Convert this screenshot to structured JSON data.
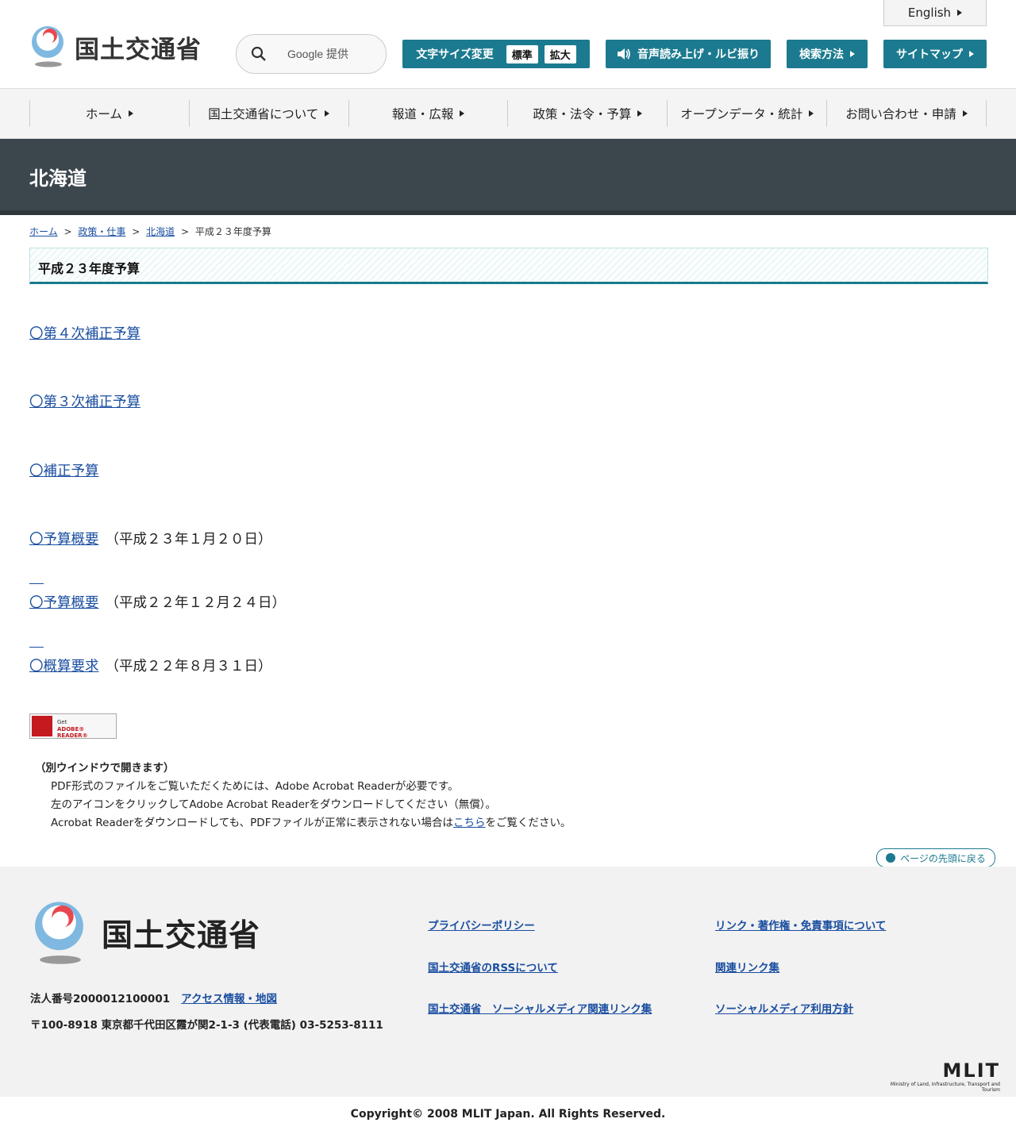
{
  "header": {
    "logo_text": "国土交通省",
    "search_placeholder": "Google 提供",
    "english_label": "English",
    "font_size_label": "文字サイズ変更",
    "font_size_standard": "標準",
    "font_size_large": "拡大",
    "read_aloud_label": "音声読み上げ・ルビ振り",
    "search_method_label": "検索方法",
    "sitemap_label": "サイトマップ"
  },
  "nav": {
    "items": [
      "ホーム",
      "国土交通省について",
      "報道・広報",
      "政策・法令・予算",
      "オープンデータ・統計",
      "お問い合わせ・申請"
    ]
  },
  "banner": {
    "title": "北海道"
  },
  "breadcrumb": {
    "items": [
      "ホーム",
      "政策・仕事",
      "北海道"
    ],
    "current": "平成２３年度予算",
    "separator": ">"
  },
  "page_heading": "平成２３年度予算",
  "entries": [
    {
      "link": "〇第４次補正予算",
      "note": ""
    },
    {
      "link": "〇第３次補正予算",
      "note": ""
    },
    {
      "link": "〇補正予算",
      "note": ""
    },
    {
      "link": "〇予算概要",
      "note": "（平成２３年１月２０日）"
    },
    {
      "link": "〇予算概要",
      "note": "（平成２２年１２月２４日）"
    },
    {
      "link": "〇概算要求",
      "note": "（平成２２年８月３１日）"
    }
  ],
  "adobe": {
    "get": "Get",
    "reader": "ADOBE® READER®"
  },
  "pdf_note": {
    "title": "（別ウインドウで開きます）",
    "line1": "PDF形式のファイルをご覧いただくためには、Adobe Acrobat Readerが必要です。",
    "line2": "左のアイコンをクリックしてAdobe Acrobat Readerをダウンロードしてください（無償）。",
    "line3_pre": "Acrobat Readerをダウンロードしても、PDFファイルが正常に表示されない場合は",
    "line3_link": "こちら",
    "line3_post": "をご覧ください。"
  },
  "back_to_top": "ページの先頭に戻る",
  "footer": {
    "logo_text": "国土交通省",
    "corp_number": "法人番号2000012100001",
    "access_link": "アクセス情報・地図",
    "address": "〒100-8918 東京都千代田区霞が関2-1-3 (代表電話) 03-5253-8111",
    "links": [
      "プライバシーポリシー",
      "リンク・著作権・免責事項について",
      "国土交通省のRSSについて",
      "関連リンク集",
      "国土交通省　ソーシャルメディア関連リンク集",
      "ソーシャルメディア利用方針"
    ],
    "mlit_big": "MLIT",
    "mlit_small": "Ministry of Land, Infrastructure, Transport and Tourism",
    "copyright": "Copyright© 2008 MLIT Japan. All Rights Reserved."
  },
  "colors": {
    "teal": "#1b7a8f",
    "banner": "#3c474d",
    "link": "#1a4ea0"
  }
}
